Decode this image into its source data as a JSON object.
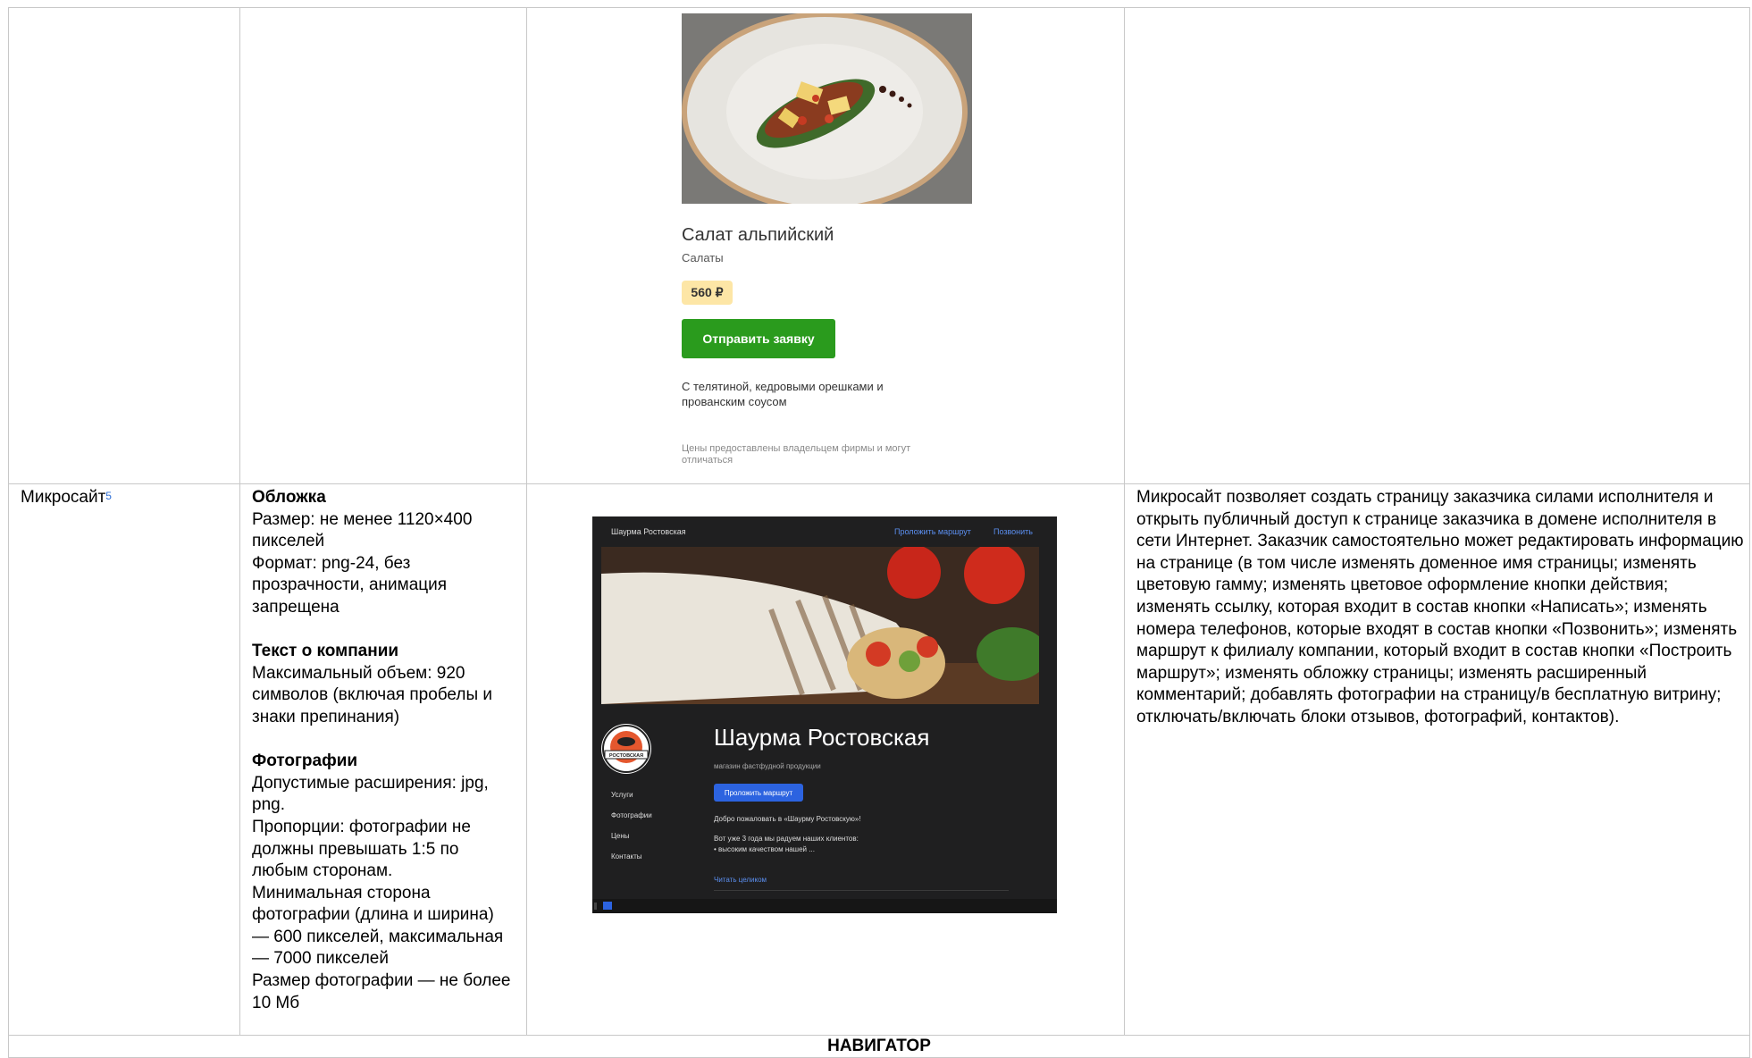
{
  "product_card": {
    "title": "Салат альпийский",
    "category": "Салаты",
    "price": "560 ₽",
    "order_button": "Отправить заявку",
    "description": "С телятиной, кедровыми орешками и прованским соусом",
    "note": "Цены предоставлены владельцем фирмы и могут отличаться"
  },
  "row_microsite": {
    "name": "Микросайт",
    "footnote": "5",
    "requirements": {
      "cover_heading": "Обложка",
      "cover_lines": [
        "Размер: не менее 1120×400 пикселей",
        "Формат: png-24, без прозрачности, анимация запрещена"
      ],
      "text_heading": "Текст о компании",
      "text_lines": [
        "Максимальный объем: 920 символов (включая пробелы и знаки препинания)"
      ],
      "photos_heading": "Фотографии",
      "photos_lines": [
        "Допустимые расширения: jpg, png.",
        "Пропорции: фотографии не должны превышать 1:5 по любым сторонам.",
        "Минимальная сторона фотографии (длина и ширина) — 600 пикселей, максимальная — 7000 пикселей",
        "Размер фотографии — не более 10 Мб"
      ]
    },
    "description": "Микросайт позволяет создать страницу заказчика силами исполнителя и открыть публичный доступ к странице заказчика в домене исполнителя в сети Интернет. Заказчик самостоятельно может редактировать информацию на странице (в том числе изменять доменное имя страницы; изменять цветовую гамму; изменять цветовое оформление кнопки действия; изменять ссылку, которая входит в состав кнопки «Написать»; изменять номера телефонов, которые входят в состав кнопки «Позвонить»; изменять маршрут к филиалу компании, который входит в состав кнопки «Построить маршрут»; изменять обложку страницы; изменять расширенный комментарий; добавлять фотографии на страницу/в бесплатную витрину; отключать/включать блоки отзывов, фотографий, контактов)."
  },
  "microsite_preview": {
    "site_name_small": "Шаурма Ростовская",
    "route_link": "Проложить маршрут",
    "call_link": "Позвонить",
    "title": "Шаурма Ростовская",
    "subtitle": "магазин фастфудной продукции",
    "route_button": "Проложить маршрут",
    "logo_text": "РОСТОВСКАЯ",
    "nav": [
      "Услуги",
      "Фотографии",
      "Цены",
      "Контакты"
    ],
    "welcome": "Добро пожаловать в «Шаурму Ростовскую»!",
    "para_line1": "Вот уже 3 года мы радуем наших клиентов:",
    "para_line2": "• высоким качеством нашей ...",
    "read_more": "Читать целиком"
  },
  "section_heading": "НАВИГАТОР",
  "colors": {
    "order_green": "#2a9b1d",
    "price_bg": "#fde6a6",
    "link_blue": "#2c63e0"
  }
}
